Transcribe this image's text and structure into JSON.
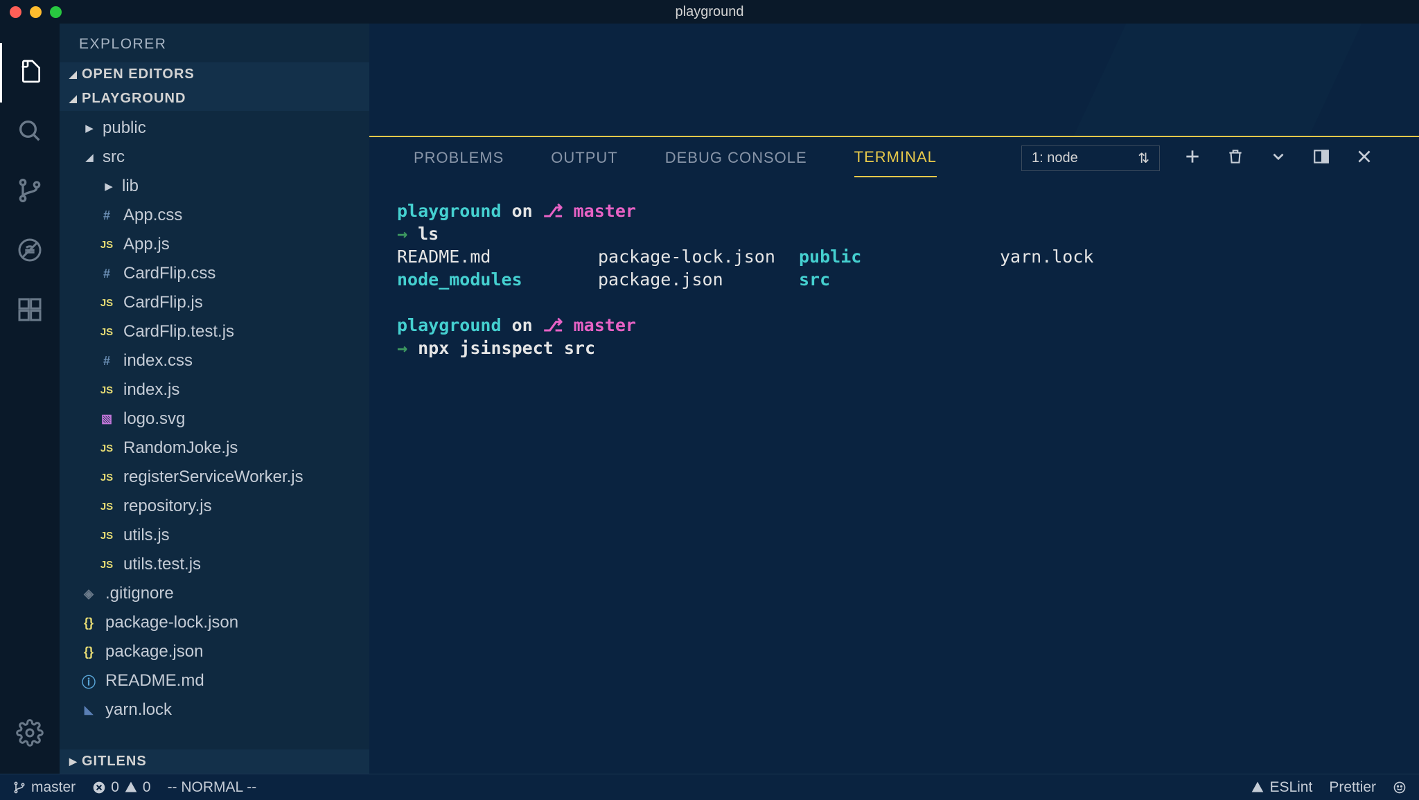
{
  "window": {
    "title": "playground"
  },
  "sidebar": {
    "title": "EXPLORER",
    "sections": {
      "openEditors": "OPEN EDITORS",
      "workspace": "PLAYGROUND",
      "gitlens": "GITLENS"
    }
  },
  "files": {
    "public": "public",
    "src": "src",
    "lib": "lib",
    "appCss": "App.css",
    "appJs": "App.js",
    "cardFlipCss": "CardFlip.css",
    "cardFlipJs": "CardFlip.js",
    "cardFlipTest": "CardFlip.test.js",
    "indexCss": "index.css",
    "indexJs": "index.js",
    "logoSvg": "logo.svg",
    "randomJoke": "RandomJoke.js",
    "rsw": "registerServiceWorker.js",
    "repository": "repository.js",
    "utils": "utils.js",
    "utilsTest": "utils.test.js",
    "gitignore": ".gitignore",
    "pkgLock": "package-lock.json",
    "pkg": "package.json",
    "readme": "README.md",
    "yarnLock": "yarn.lock"
  },
  "panel": {
    "tabs": {
      "problems": "PROBLEMS",
      "output": "OUTPUT",
      "debug": "DEBUG CONSOLE",
      "terminal": "TERMINAL"
    },
    "terminalSelect": "1: node"
  },
  "terminal": {
    "block1": {
      "cwd": "playground",
      "on": "on",
      "branch": "master",
      "cmd": "ls",
      "ls": {
        "r1c1": "README.md",
        "r1c2": "package-lock.json",
        "r1c3": "public",
        "r1c4": "yarn.lock",
        "r2c1": "node_modules",
        "r2c2": "package.json",
        "r2c3": "src"
      }
    },
    "block2": {
      "cwd": "playground",
      "on": "on",
      "branch": "master",
      "cmd": "npx jsinspect src"
    }
  },
  "status": {
    "branch": "master",
    "errors": "0",
    "warnings": "0",
    "mode": "-- NORMAL --",
    "eslint": "ESLint",
    "prettier": "Prettier"
  }
}
